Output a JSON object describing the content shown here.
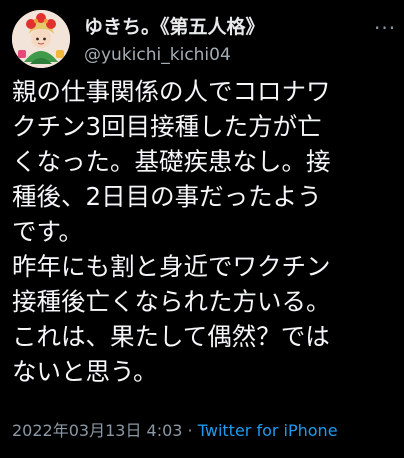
{
  "author": {
    "display_name": "ゆきち。《第五人格》",
    "handle": "@yukichi_kichi04"
  },
  "menu": {
    "more_label": "···"
  },
  "tweet": {
    "lines": [
      "親の仕事関係の人でコロナワ",
      "クチン3回目接種した方が亡",
      "くなった。基礎疾患なし。接",
      "種後、2日目の事だったよう",
      "です。",
      "昨年にも割と身近でワクチン",
      "接種後亡くなられた方いる。",
      "これは、果たして偶然？では",
      "ないと思う。"
    ]
  },
  "meta": {
    "datetime": "2022年03月13日 4:03",
    "separator": " · ",
    "source": "Twitter for iPhone"
  },
  "colors": {
    "background": "#000000",
    "text": "#e7e9ea",
    "secondary": "#8b98a5",
    "link": "#1d9bf0"
  }
}
